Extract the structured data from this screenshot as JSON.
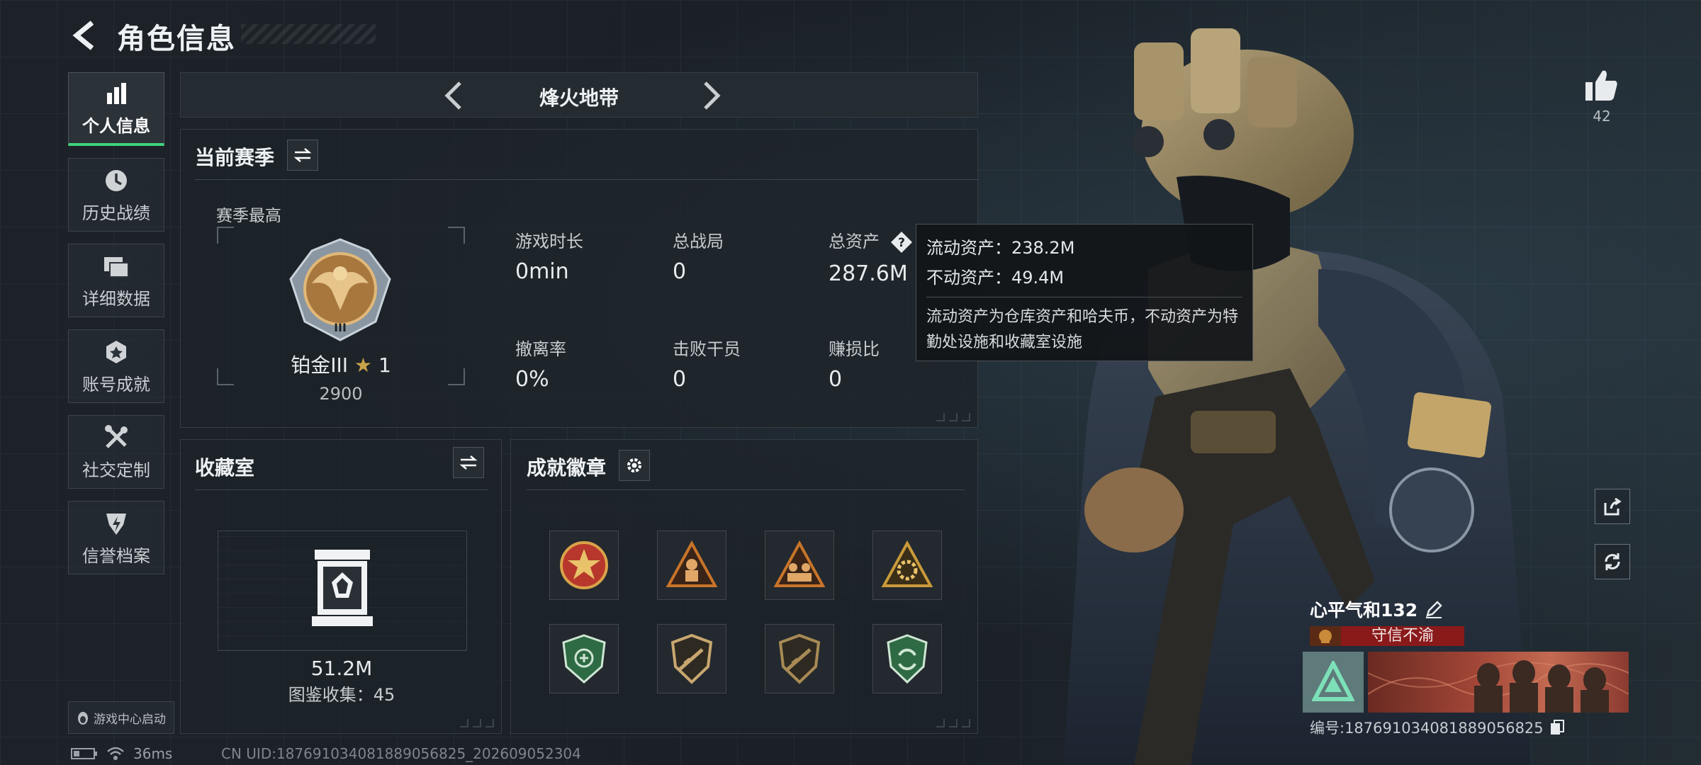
{
  "header": {
    "title": "角色信息"
  },
  "nav": {
    "items": [
      {
        "label": "个人信息",
        "icon": "bar-chart-icon",
        "active": true
      },
      {
        "label": "历史战绩",
        "icon": "clock-icon"
      },
      {
        "label": "详细数据",
        "icon": "folders-icon"
      },
      {
        "label": "账号成就",
        "icon": "medal-star-icon"
      },
      {
        "label": "社交定制",
        "icon": "tools-icon"
      },
      {
        "label": "信誉档案",
        "icon": "shield-bolt-icon"
      }
    ],
    "game_center": "游戏中心启动"
  },
  "mode": {
    "title": "烽火地带"
  },
  "season": {
    "title": "当前赛季",
    "best_label": "赛季最高",
    "rank_name": "铂金III",
    "rank_stars": "1",
    "rank_points": "2900",
    "rank_badge_numeral": "III",
    "stats": [
      {
        "label": "游戏时长",
        "value": "0min"
      },
      {
        "label": "总战局",
        "value": "0"
      },
      {
        "label": "总资产",
        "value": "287.6M"
      },
      {
        "label": "撤离率",
        "value": "0%"
      },
      {
        "label": "击败干员",
        "value": "0"
      },
      {
        "label": "赚损比",
        "value": "0"
      }
    ]
  },
  "tooltip": {
    "liquid": "流动资产：238.2M",
    "fixed": "不动资产：49.4M",
    "description": "流动资产为仓库资产和哈夫币，不动资产为特勤处设施和收藏室设施"
  },
  "collection": {
    "title": "收藏室",
    "value": "51.2M",
    "catalog": "图鉴收集：45"
  },
  "achievements": {
    "title": "成就徽章",
    "badges": [
      {
        "icon": "star-medal-icon",
        "color": "#b8372c"
      },
      {
        "icon": "triangle-soldier-icon",
        "color": "#c8742a"
      },
      {
        "icon": "triangle-squad-icon",
        "color": "#c8742a"
      },
      {
        "icon": "triangle-gear-icon",
        "color": "#c99a3a"
      },
      {
        "icon": "green-shield-icon",
        "color": "#3c8a56"
      },
      {
        "icon": "rifle-shield-icon",
        "color": "#c8a770"
      },
      {
        "icon": "rifle-shield-icon",
        "color": "#a88a55"
      },
      {
        "icon": "green-cycle-shield-icon",
        "color": "#3c9a5c"
      }
    ]
  },
  "profile": {
    "likes": "42",
    "name": "心平气和132",
    "credit": "守信不渝",
    "id": "编号:187691034081889056825"
  },
  "status": {
    "ping": "36ms",
    "uid": "CN UID:187691034081889056825_202609052304"
  },
  "colors": {
    "accent_green": "#3ed37b",
    "credit_red": "#8a1a1a"
  }
}
